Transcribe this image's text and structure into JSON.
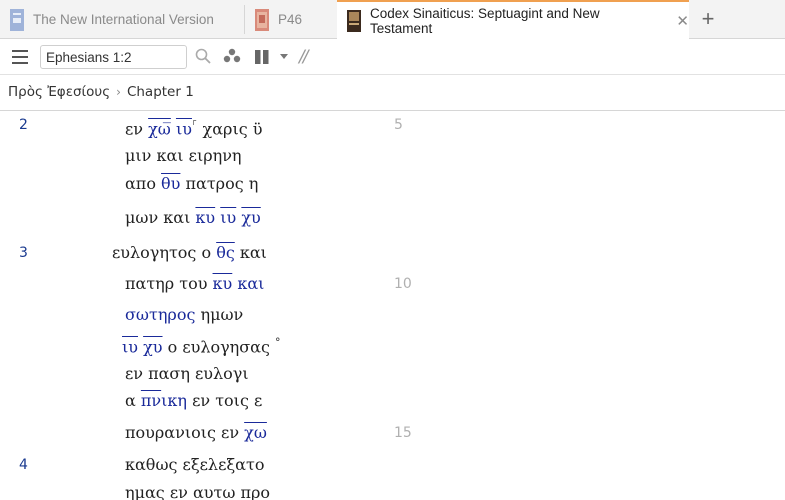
{
  "tabs": [
    {
      "label": "The New International Version",
      "icon": "book-cover-icon"
    },
    {
      "label": "P46",
      "icon": "manuscript-cover-icon"
    },
    {
      "label": "Codex Sinaiticus: Septuagint and New Testament",
      "icon": "codex-cover-icon",
      "close": "✕"
    }
  ],
  "toolbar": {
    "reference_value": "Ephesians 1:2",
    "parallel_glyph": "//",
    "add_tab_glyph": "+"
  },
  "breadcrumb": {
    "book": "Πρὸς Ἐφεσίους",
    "separator": "›",
    "chapter": "Chapter 1"
  },
  "text": {
    "verse_2": "2",
    "verse_3": "3",
    "verse_4": "4",
    "line_no_5": "5",
    "line_no_10": "10",
    "line_no_15": "15",
    "l1_a": "εν ",
    "l1_ns1": "χω̅",
    "l1_sp": " ",
    "l1_ns2": "ιυ",
    "l1_mark": "⸀",
    "l1_b": " χαρις ϋ",
    "l2": "μιν και ειρηνη",
    "l3_a": "απο ",
    "l3_ns": "θυ",
    "l3_b": " πατρος η",
    "l4_a": "μων και ",
    "l4_ns1": "κυ",
    "l4_ns2": "ιυ",
    "l4_ns3": "χυ",
    "l5_a": "ευλογητος ο ",
    "l5_ns": "θς",
    "l5_b": " και",
    "l6_a": "πατηρ του ",
    "l6_ns": "κυ",
    "l6_hl": " και",
    "l7_hl": "σωτηρος",
    "l7_b": " ημων",
    "l8_ns1": "ιυ",
    "l8_ns2": "χυ",
    "l8_b": " ο ευλογησας ",
    "l8_mark": "°",
    "l9": "εν παση ευλογι",
    "l10_a": "α ",
    "l10_ns": "πν",
    "l10_hl": "ικη",
    "l10_b": " εν τοις ε",
    "l11_a": "πουρανιοις εν ",
    "l11_ns": "χω",
    "l12": "καθως εξελεξατο",
    "l13": "ημας εν αυτω προ"
  }
}
